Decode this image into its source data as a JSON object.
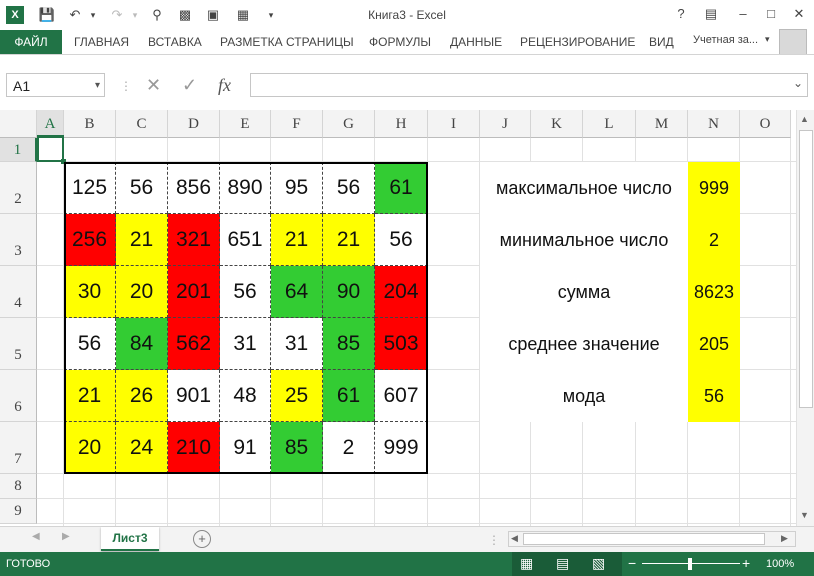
{
  "titlebar": {
    "title": "Книга3 - Excel",
    "help": "?"
  },
  "ribbon": {
    "file": "ФАЙЛ",
    "tabs": [
      "ГЛАВНАЯ",
      "ВСТАВКА",
      "РАЗМЕТКА СТРАНИЦЫ",
      "ФОРМУЛЫ",
      "ДАННЫЕ",
      "РЕЦЕНЗИРОВАНИЕ",
      "ВИД"
    ],
    "account": "Учетная за..."
  },
  "formula_bar": {
    "name_box": "A1",
    "fx": "fx",
    "formula": ""
  },
  "columns": [
    "A",
    "B",
    "C",
    "D",
    "E",
    "F",
    "G",
    "H",
    "I",
    "J",
    "K",
    "L",
    "M",
    "N",
    "O"
  ],
  "rows": [
    "1",
    "2",
    "3",
    "4",
    "5",
    "6",
    "7",
    "8",
    "9"
  ],
  "table": [
    [
      {
        "v": "125",
        "c": "white"
      },
      {
        "v": "56",
        "c": "white"
      },
      {
        "v": "856",
        "c": "white"
      },
      {
        "v": "890",
        "c": "white"
      },
      {
        "v": "95",
        "c": "white"
      },
      {
        "v": "56",
        "c": "white"
      },
      {
        "v": "61",
        "c": "green"
      }
    ],
    [
      {
        "v": "256",
        "c": "red"
      },
      {
        "v": "21",
        "c": "yellow"
      },
      {
        "v": "321",
        "c": "red"
      },
      {
        "v": "651",
        "c": "white"
      },
      {
        "v": "21",
        "c": "yellow"
      },
      {
        "v": "21",
        "c": "yellow"
      },
      {
        "v": "56",
        "c": "white"
      }
    ],
    [
      {
        "v": "30",
        "c": "yellow"
      },
      {
        "v": "20",
        "c": "yellow"
      },
      {
        "v": "201",
        "c": "red"
      },
      {
        "v": "56",
        "c": "white"
      },
      {
        "v": "64",
        "c": "green"
      },
      {
        "v": "90",
        "c": "green"
      },
      {
        "v": "204",
        "c": "red"
      }
    ],
    [
      {
        "v": "56",
        "c": "white"
      },
      {
        "v": "84",
        "c": "green"
      },
      {
        "v": "562",
        "c": "red"
      },
      {
        "v": "31",
        "c": "white"
      },
      {
        "v": "31",
        "c": "white"
      },
      {
        "v": "85",
        "c": "green"
      },
      {
        "v": "503",
        "c": "red"
      }
    ],
    [
      {
        "v": "21",
        "c": "yellow"
      },
      {
        "v": "26",
        "c": "yellow"
      },
      {
        "v": "901",
        "c": "white"
      },
      {
        "v": "48",
        "c": "white"
      },
      {
        "v": "25",
        "c": "yellow"
      },
      {
        "v": "61",
        "c": "green"
      },
      {
        "v": "607",
        "c": "white"
      }
    ],
    [
      {
        "v": "20",
        "c": "yellow"
      },
      {
        "v": "24",
        "c": "yellow"
      },
      {
        "v": "210",
        "c": "red"
      },
      {
        "v": "91",
        "c": "white"
      },
      {
        "v": "85",
        "c": "green"
      },
      {
        "v": "2",
        "c": "white"
      },
      {
        "v": "999",
        "c": "white"
      }
    ]
  ],
  "stats": [
    {
      "label": "максимальное число",
      "value": "999"
    },
    {
      "label": "минимальное число",
      "value": "2"
    },
    {
      "label": "сумма",
      "value": "8623"
    },
    {
      "label": "среднее значение",
      "value": "205"
    },
    {
      "label": "мода",
      "value": "56"
    }
  ],
  "colors": {
    "yellow": "#ffff00",
    "red": "#ff0000",
    "green": "#33cc33",
    "accent": "#217346"
  },
  "sheet": {
    "tab": "Лист3",
    "add": "+"
  },
  "status": {
    "state": "ГОТОВО",
    "zoom": "100%",
    "zoom_minus": "−",
    "zoom_plus": "+"
  }
}
